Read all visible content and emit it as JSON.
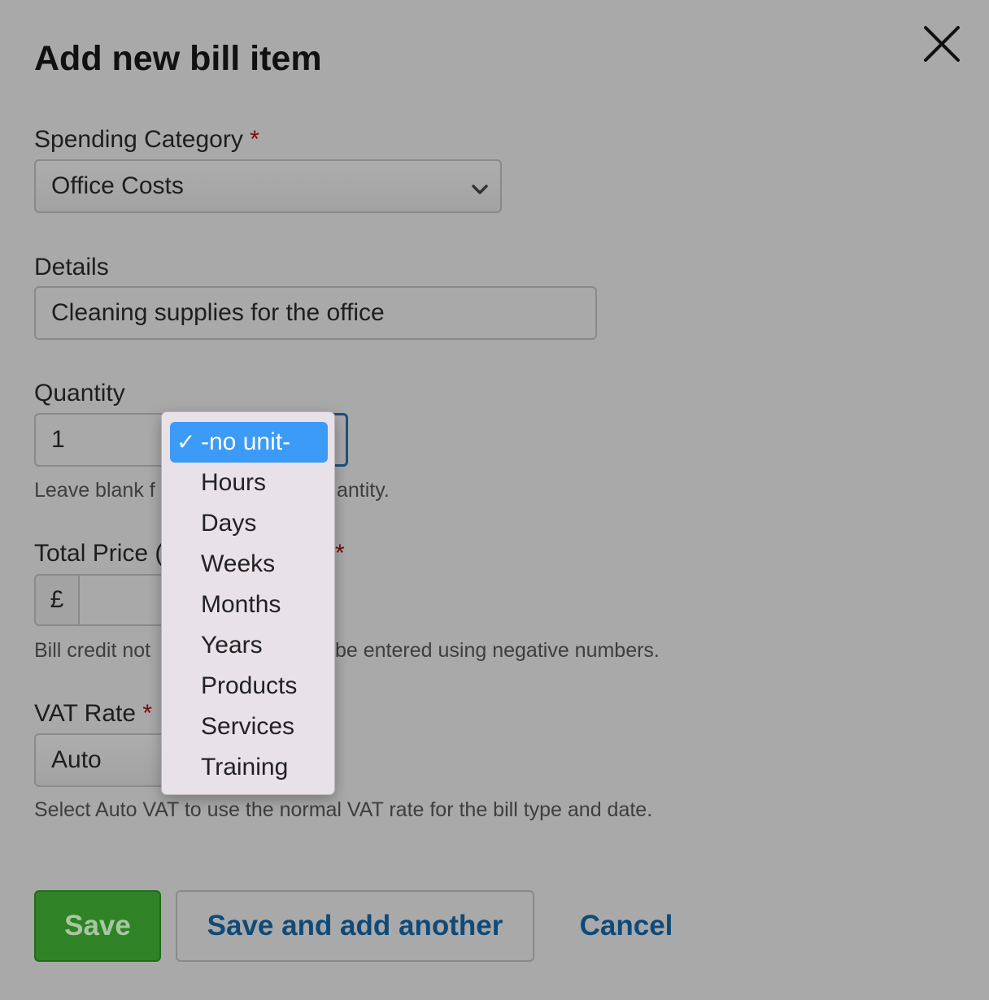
{
  "dialog": {
    "title": "Add new bill item"
  },
  "icons": {
    "close": "close-icon",
    "chevron": "chevron-down-icon",
    "check": "checkmark-icon"
  },
  "required_marker": "*",
  "spending_category": {
    "label": "Spending Category",
    "value": "Office Costs"
  },
  "details": {
    "label": "Details",
    "value": "Cleaning supplies for the office"
  },
  "quantity": {
    "label": "Quantity",
    "value": "1",
    "help": "Leave blank f",
    "help_tail": "antity.",
    "unit_options": [
      "-no unit-",
      "Hours",
      "Days",
      "Weeks",
      "Months",
      "Years",
      "Products",
      "Services",
      "Training"
    ],
    "selected_unit": "-no unit-",
    "check_mark": "✓"
  },
  "total_price": {
    "label": "Total Price (",
    "currency_symbol": "£",
    "value": "",
    "help": "Bill credit not",
    "help_tail": "be entered using negative numbers."
  },
  "vat_rate": {
    "label": "VAT Rate",
    "value": "Auto",
    "help": "Select Auto VAT to use the normal VAT rate for the bill type and date."
  },
  "buttons": {
    "save": "Save",
    "save_another": "Save and add another",
    "cancel": "Cancel"
  },
  "colors": {
    "overlay": "#a9a9a9",
    "save_green": "#2f8326",
    "link_blue": "#0f4a78",
    "selected_blue": "#3d9bf8",
    "dropdown_bg": "#e8e2e8",
    "required_red": "#7a0a0a"
  }
}
